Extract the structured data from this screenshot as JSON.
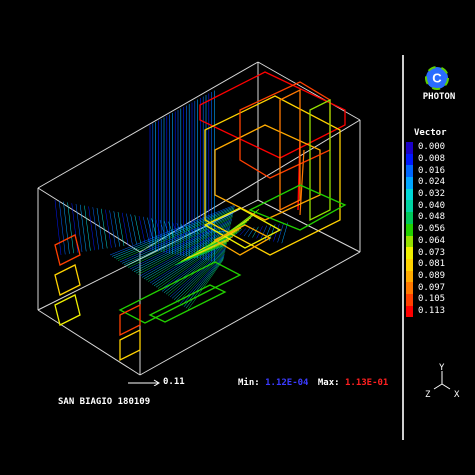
{
  "brand": {
    "name": "PHOTON",
    "logo_letter": "C"
  },
  "legend": {
    "title": "Vector",
    "entries": [
      {
        "label": "0.000",
        "color": "#1b00c8"
      },
      {
        "label": "0.008",
        "color": "#0018ff"
      },
      {
        "label": "0.016",
        "color": "#0066ff"
      },
      {
        "label": "0.024",
        "color": "#00a6ff"
      },
      {
        "label": "0.032",
        "color": "#00d8d8"
      },
      {
        "label": "0.040",
        "color": "#00d2a0"
      },
      {
        "label": "0.048",
        "color": "#00c85a"
      },
      {
        "label": "0.056",
        "color": "#22d000"
      },
      {
        "label": "0.064",
        "color": "#96e000"
      },
      {
        "label": "0.073",
        "color": "#f0f000"
      },
      {
        "label": "0.081",
        "color": "#ffd200"
      },
      {
        "label": "0.089",
        "color": "#ffaa00"
      },
      {
        "label": "0.097",
        "color": "#ff7800"
      },
      {
        "label": "0.105",
        "color": "#ff4000"
      },
      {
        "label": "0.113",
        "color": "#ff0000"
      }
    ]
  },
  "scale": {
    "label": "0.11"
  },
  "range": {
    "min_label": "Min:",
    "min_value": "1.12E-04",
    "max_label": "Max:",
    "max_value": "1.13E-01",
    "min_color": "#3b3bff",
    "max_color": "#ff2020"
  },
  "caption": "SAN BIAGIO 180109",
  "axes": {
    "y": "Y",
    "z": "Z",
    "x": "X"
  }
}
